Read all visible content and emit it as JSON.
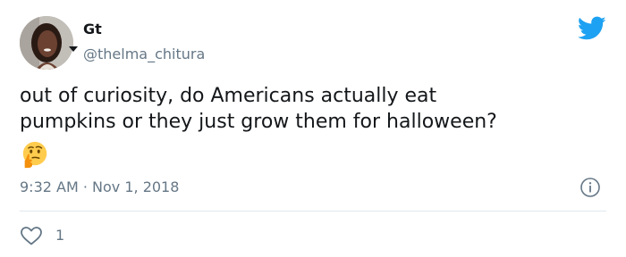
{
  "author": {
    "name": "Gt",
    "handle": "@thelma_chitura"
  },
  "tweet": {
    "text": "out of curiosity, do Americans actually eat\npumpkins or they just grow them for halloween?",
    "emoji": "thinking-face",
    "timestamp": "9:32 AM · Nov 1, 2018"
  },
  "engagement": {
    "likes": "1"
  },
  "colors": {
    "brand": "#1da1f2",
    "secondary_text": "#657786",
    "primary_text": "#14171a",
    "divider": "#e1e8ed"
  },
  "icons": [
    "twitter-bird-icon",
    "info-icon",
    "heart-icon",
    "chevron-down-icon",
    "thinking-face-emoji"
  ]
}
